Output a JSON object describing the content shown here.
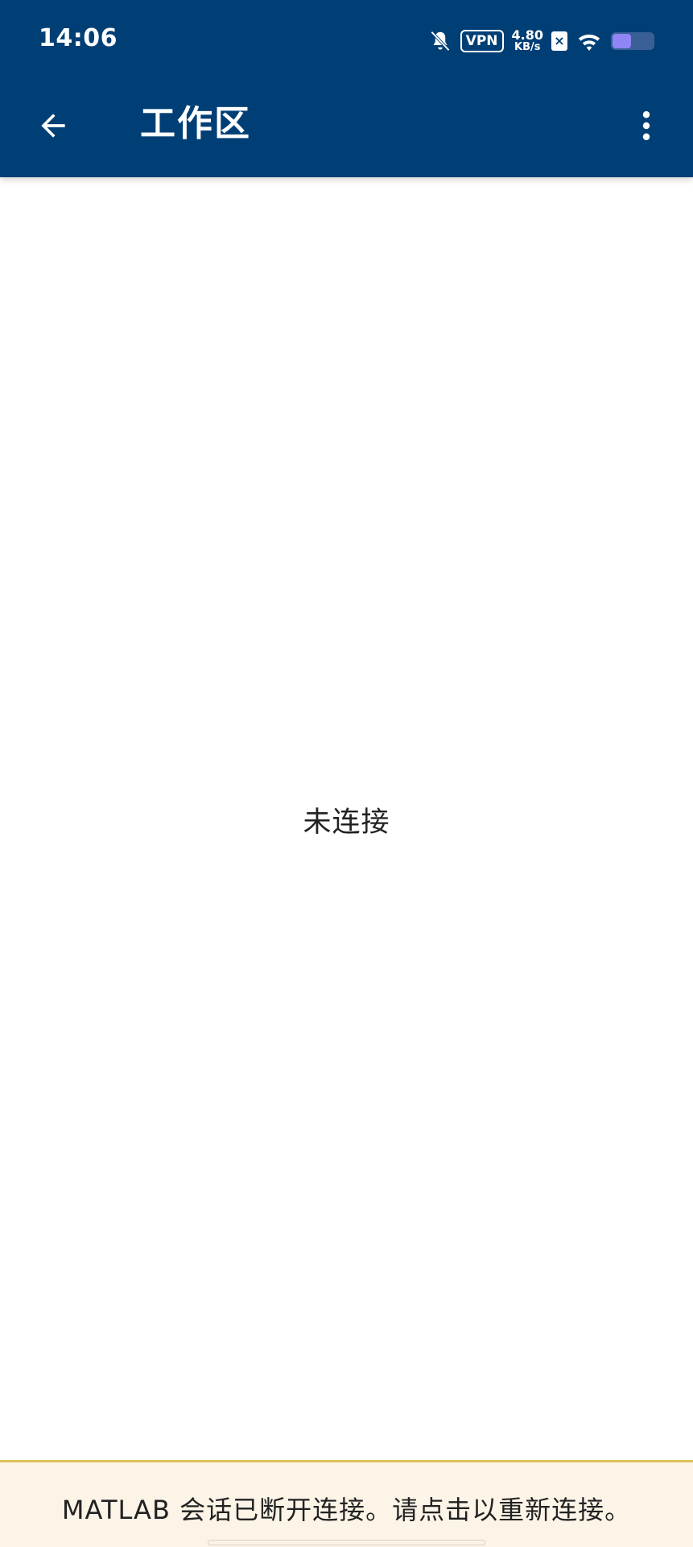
{
  "status_bar": {
    "time": "14:06",
    "vpn_label": "VPN",
    "net_speed_value": "4.80",
    "net_speed_unit": "KB/s",
    "sim_mark": "×",
    "battery_level": 0.45,
    "icons": [
      "notifications-off-icon",
      "vpn-icon",
      "network-speed",
      "sim-disabled-icon",
      "wifi-icon",
      "battery-icon"
    ]
  },
  "toolbar": {
    "back_icon": "arrow-left-icon",
    "title": "工作区",
    "more_icon": "more-vertical-icon"
  },
  "content": {
    "empty_message": "未连接"
  },
  "banner": {
    "message": "MATLAB 会话已断开连接。请点击以重新连接。"
  },
  "colors": {
    "appbar_bg": "#003f75",
    "banner_bg": "#fcf4e7",
    "banner_border": "#dfc25a",
    "battery_fill": "#8f85f4"
  }
}
